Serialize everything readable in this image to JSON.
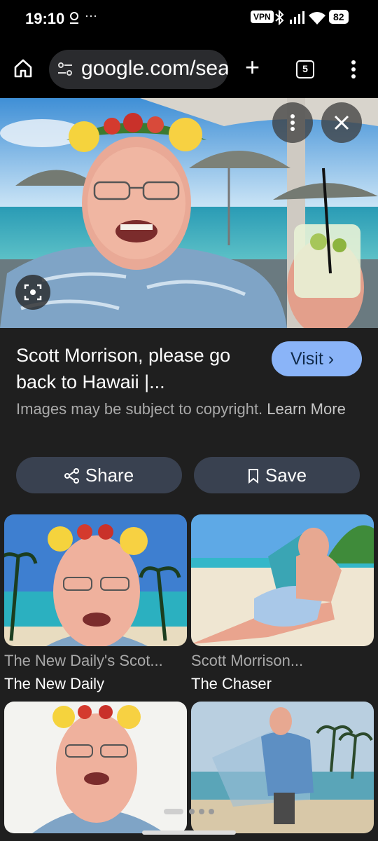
{
  "status": {
    "time": "19:10",
    "vpn": "VPN",
    "battery": "82",
    "dots": "···"
  },
  "toolbar": {
    "url": "google.com/search",
    "tab_count": "5"
  },
  "result": {
    "title": "Scott Morrison, please go back to Hawaii |...",
    "visit_label": "Visit ›",
    "copyright_text": "Images may be subject to copyright.",
    "learn_more": "Learn More",
    "share_label": "Share",
    "save_label": "Save"
  },
  "related": [
    {
      "title": "The New Daily's Scot...",
      "source": "The New Daily"
    },
    {
      "title": "Scott Morrison...",
      "source": "The Chaser"
    },
    {
      "title": "",
      "source": ""
    },
    {
      "title": "",
      "source": ""
    }
  ],
  "icons": {
    "home": "home-icon",
    "site_settings": "tune-icon",
    "new_tab": "plus-icon",
    "tabs": "tab-switcher-icon",
    "menu": "more-vert-icon",
    "close": "close-icon",
    "lens": "lens-icon",
    "share": "share-icon",
    "save": "bookmark-icon"
  },
  "colors": {
    "accent": "#8ab4f8",
    "panel": "#1f1f1f",
    "button": "#394150"
  }
}
